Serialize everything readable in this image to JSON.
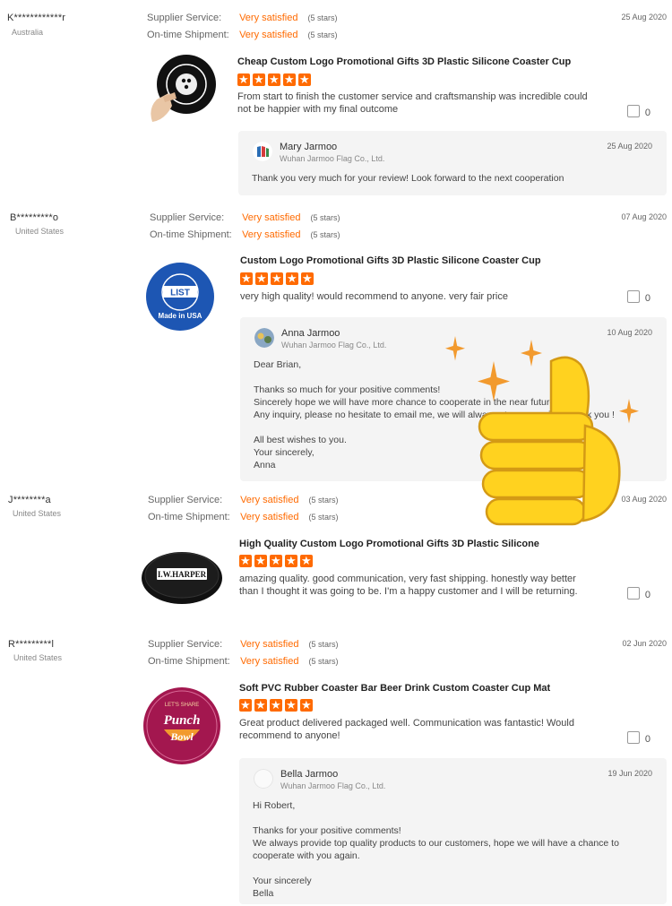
{
  "labels": {
    "supplier_service": "Supplier Service:",
    "on_time_shipment": "On-time Shipment:",
    "rating_text": "Very satisfied",
    "stars_note": "(5 stars)"
  },
  "reviews": [
    {
      "user": "K************r",
      "country": "Australia",
      "date": "25 Aug 2020",
      "title": "Cheap Custom Logo Promotional Gifts 3D Plastic Silicone Coaster Cup",
      "stars": 5,
      "comment": "From start to finish the customer service and craftsmanship was incredible could not be happier with my final outcome",
      "likes": "0",
      "reply": {
        "name": "Mary Jarmoo",
        "company": "Wuhan Jarmoo Flag Co., Ltd.",
        "date": "25 Aug 2020",
        "body": "Thank you very much for your review! Look forward to the next cooperation"
      }
    },
    {
      "user": "B*********o",
      "country": "United States",
      "date": "07 Aug 2020",
      "title": "Custom Logo Promotional Gifts 3D Plastic Silicone Coaster Cup",
      "stars": 5,
      "comment": "very high quality! would recommend to anyone. very fair price",
      "likes": "0",
      "image_text": [
        "LIST",
        "Made in USA"
      ],
      "reply": {
        "name": "Anna Jarmoo",
        "company": "Wuhan Jarmoo Flag Co., Ltd.",
        "date": "10 Aug 2020",
        "body": "Dear Brian,\n\nThanks so much for your positive comments!\nSincerely hope we will have more chance to cooperate in the near future\nAny inquiry, please no hesitate to email me, we will always at your service. Thank you !\n\nAll best wishes to you.\nYour sincerely,\nAnna"
      }
    },
    {
      "user": "J********a",
      "country": "United States",
      "date": "03 Aug 2020",
      "title": "High Quality Custom Logo Promotional Gifts 3D Plastic Silicone",
      "stars": 5,
      "comment": "amazing quality. good communication, very fast shipping.  honestly way better than I thought it was going to be. I'm a happy customer and I will be returning.",
      "likes": "0",
      "image_text": [
        "I.W.HARPER"
      ]
    },
    {
      "user": "R*********l",
      "country": "United States",
      "date": "02 Jun 2020",
      "title": "Soft PVC Rubber Coaster Bar Beer Drink Custom Coaster Cup Mat",
      "stars": 5,
      "comment": "Great product delivered packaged well.  Communication was fantastic!  Would recommend to anyone!",
      "likes": "0",
      "image_text": [
        "LET'S SHARE",
        "Punch",
        "Bowl"
      ],
      "reply": {
        "name": "Bella Jarmoo",
        "company": "Wuhan Jarmoo Flag Co., Ltd.",
        "date": "19 Jun 2020",
        "body": "Hi Robert,\n\nThanks for your positive comments!\nWe always provide top quality products to our customers, hope we will have a chance to cooperate with you again.\n\nYour sincerely\nBella"
      }
    }
  ],
  "colors": {
    "accent": "#ff6a00",
    "reply_bg": "#f4f4f4",
    "thumbs_yellow": "#ffd21f",
    "sparkle": "#f29a2e"
  },
  "overlay_icon": "thumbs-up-emoji"
}
